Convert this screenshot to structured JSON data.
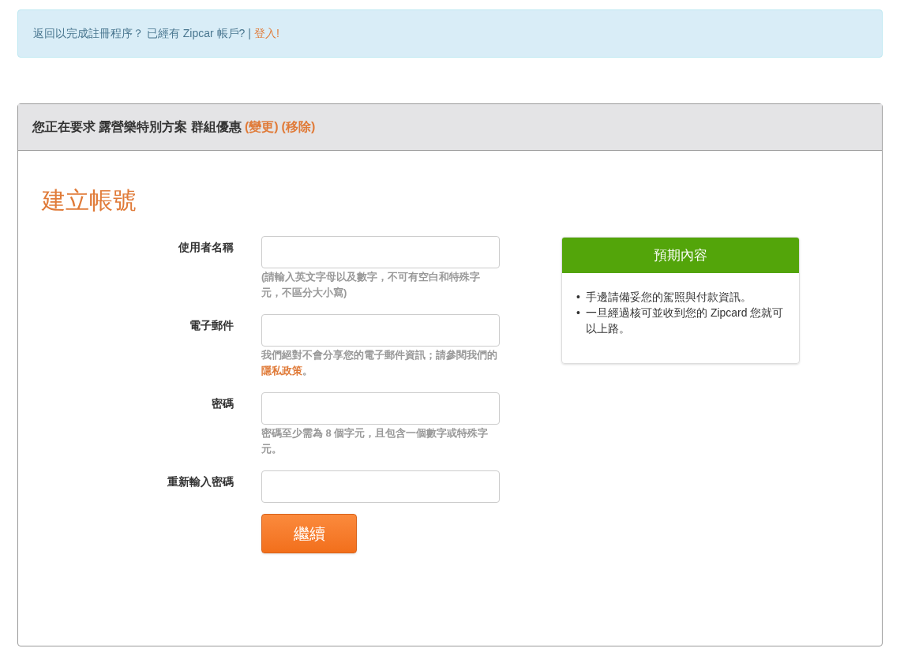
{
  "banner": {
    "text": "返回以完成註冊程序？ 已經有 Zipcar 帳戶? |",
    "link": "登入!"
  },
  "panel": {
    "header": {
      "text": "您正在要求 露營樂特別方案 群組優惠",
      "links": [
        "(變更)",
        "(移除)"
      ]
    },
    "title": "建立帳號",
    "fields": [
      {
        "label": "使用者名稱",
        "hint": [
          {
            "kind": "text",
            "text": "(請輸入英文字母以及數字，不可有空白和特殊字元，不區分大小寫)"
          }
        ]
      },
      {
        "label": "電子郵件",
        "hint": [
          {
            "kind": "text",
            "text": "我們絕對不會分享您的電子郵件資訊；請參閱我們的"
          },
          {
            "kind": "link",
            "text": "隱私政策"
          },
          {
            "kind": "text",
            "text": "。"
          }
        ]
      },
      {
        "label": "密碼",
        "hint": [
          {
            "kind": "text",
            "text": "密碼至少需為 8 個字元，且包含一個數字或特殊字元。"
          }
        ]
      },
      {
        "label": "重新輸入密碼"
      }
    ],
    "submit": "繼續",
    "sidebar": {
      "title": "預期內容",
      "items": [
        {
          "bullet": "•",
          "text": "手邊請備妥您的駕照與付款資訊。"
        },
        {
          "bullet": "•",
          "text": "一旦經過核可並收到您的 Zipcard 您就可以上路。"
        }
      ]
    }
  }
}
